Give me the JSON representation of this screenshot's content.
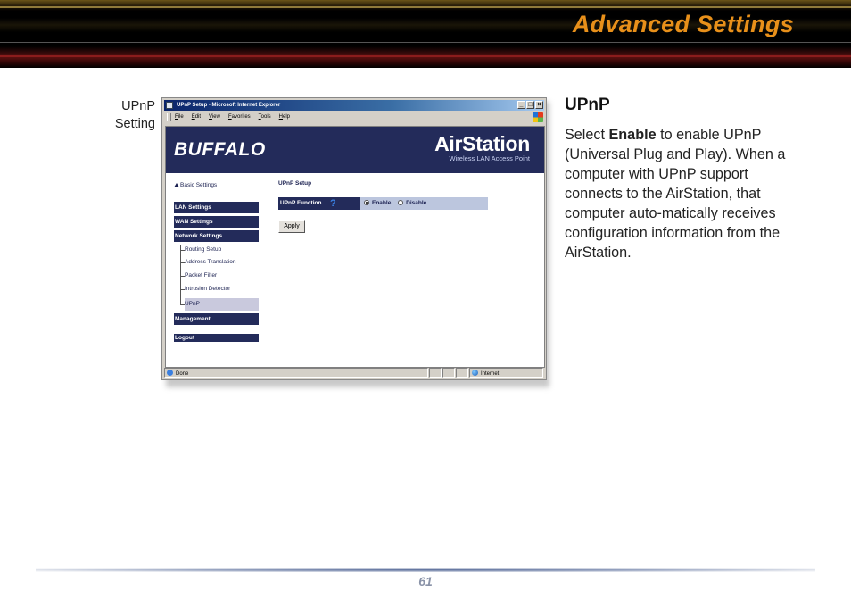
{
  "header": {
    "title": "Advanced Settings"
  },
  "caption": {
    "line1": "UPnP",
    "line2": "Setting"
  },
  "browser": {
    "title": "UPnP Setup - Microsoft Internet Explorer",
    "menu": [
      "File",
      "Edit",
      "View",
      "Favorites",
      "Tools",
      "Help"
    ],
    "status_left": "Done",
    "status_zone": "Internet"
  },
  "webpage": {
    "brand": "BUFFALO",
    "product": "AirStation",
    "product_sub": "Wireless LAN Access Point",
    "sidebar": {
      "basic": "Basic Settings",
      "lan": "LAN Settings",
      "wan": "WAN Settings",
      "network": "Network Settings",
      "sub_items": [
        "Routing Setup",
        "Address Translation",
        "Packet Filter",
        "Intrusion Detector",
        "UPnP"
      ],
      "management": "Management",
      "logout": "Logout"
    },
    "content": {
      "title": "UPnP Setup",
      "label": "UPnP Function",
      "help": "?",
      "enable": "Enable",
      "disable": "Disable",
      "selected": "Enable",
      "apply": "Apply"
    }
  },
  "section": {
    "heading": "UPnP",
    "pre": "Select ",
    "bold": "Enable",
    "post": " to enable UPnP (Universal Plug and Play).  When a computer with UPnP support connects to the AirStation, that computer auto-matically receives configuration information from the AirStation."
  },
  "footer": {
    "page": "61"
  },
  "colors": {
    "title_orange": "#e8901a",
    "nav_blue": "#232b5a"
  }
}
